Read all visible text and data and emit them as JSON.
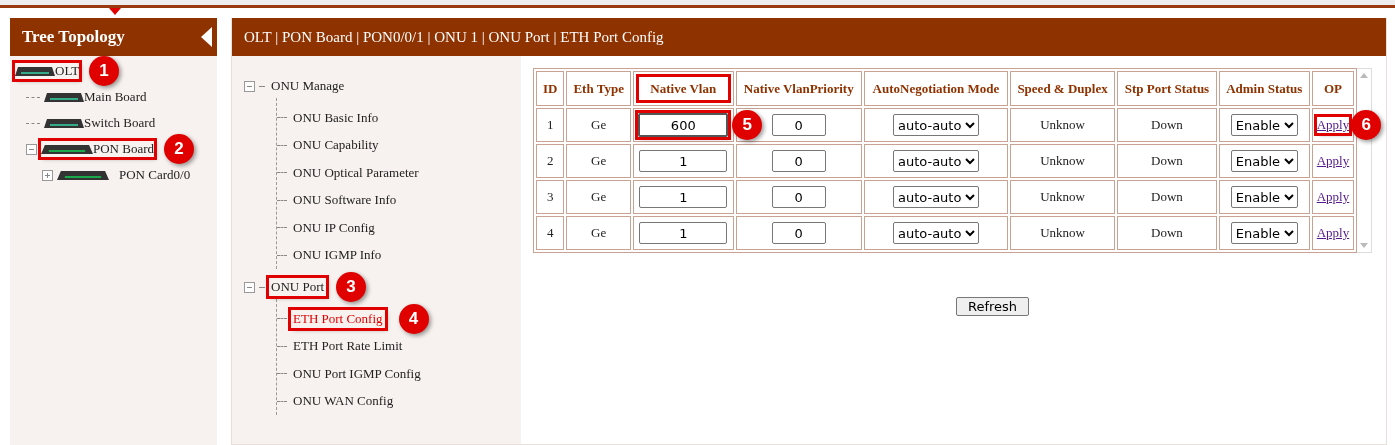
{
  "tree_panel": {
    "title": "Tree Topology",
    "nodes": [
      {
        "label": "OLT",
        "callout": "1",
        "children": [
          {
            "label": "Main Board"
          },
          {
            "label": "Switch Board"
          },
          {
            "label": "PON Board",
            "expanded": true,
            "callout": "2",
            "children": [
              {
                "label": "PON Card0/0",
                "expanded": false
              }
            ]
          }
        ]
      }
    ]
  },
  "breadcrumb": "OLT | PON Board | PON0/0/1 | ONU 1 | ONU Port | ETH Port Config",
  "menu": [
    {
      "label": "ONU Manage",
      "expanded": true,
      "children": [
        {
          "label": "ONU Basic Info",
          "selected": false
        },
        {
          "label": "ONU Capability",
          "selected": false
        },
        {
          "label": "ONU Optical Parameter",
          "selected": false
        },
        {
          "label": "ONU Software Info",
          "selected": false
        },
        {
          "label": "ONU IP Config",
          "selected": false
        },
        {
          "label": "ONU IGMP Info",
          "selected": false
        }
      ]
    },
    {
      "label": "ONU Port",
      "expanded": true,
      "callout": "3",
      "children": [
        {
          "label": "ETH Port Config",
          "selected": true,
          "callout": "4"
        },
        {
          "label": "ETH Port Rate Limit",
          "selected": false
        },
        {
          "label": "ONU Port IGMP Config",
          "selected": false
        },
        {
          "label": "ONU WAN Config",
          "selected": false
        }
      ]
    }
  ],
  "table": {
    "columns": [
      {
        "label": "ID",
        "highlighted": false
      },
      {
        "label": "Eth Type",
        "highlighted": false
      },
      {
        "label": "Native Vlan",
        "highlighted": true
      },
      {
        "label": "Native VlanPriority",
        "highlighted": false
      },
      {
        "label": "AutoNegotiation Mode",
        "highlighted": false
      },
      {
        "label": "Speed & Duplex",
        "highlighted": false
      },
      {
        "label": "Stp Port Status",
        "highlighted": false
      },
      {
        "label": "Admin Status",
        "highlighted": false
      },
      {
        "label": "OP",
        "highlighted": false
      }
    ],
    "rows": [
      {
        "id": "1",
        "eth_type": "Ge",
        "native_vlan": "600",
        "vlan_callout": "5",
        "priority": "0",
        "auto_negotiation": "auto-auto",
        "speed_duplex": "Unknow",
        "stp_status": "Down",
        "admin_status": "Enable",
        "op": "Apply",
        "op_callout": "6"
      },
      {
        "id": "2",
        "eth_type": "Ge",
        "native_vlan": "1",
        "priority": "0",
        "auto_negotiation": "auto-auto",
        "speed_duplex": "Unknow",
        "stp_status": "Down",
        "admin_status": "Enable",
        "op": "Apply"
      },
      {
        "id": "3",
        "eth_type": "Ge",
        "native_vlan": "1",
        "priority": "0",
        "auto_negotiation": "auto-auto",
        "speed_duplex": "Unknow",
        "stp_status": "Down",
        "admin_status": "Enable",
        "op": "Apply"
      },
      {
        "id": "4",
        "eth_type": "Ge",
        "native_vlan": "1",
        "priority": "0",
        "auto_negotiation": "auto-auto",
        "speed_duplex": "Unknow",
        "stp_status": "Down",
        "admin_status": "Enable",
        "op": "Apply"
      }
    ]
  },
  "refresh_button": "Refresh"
}
